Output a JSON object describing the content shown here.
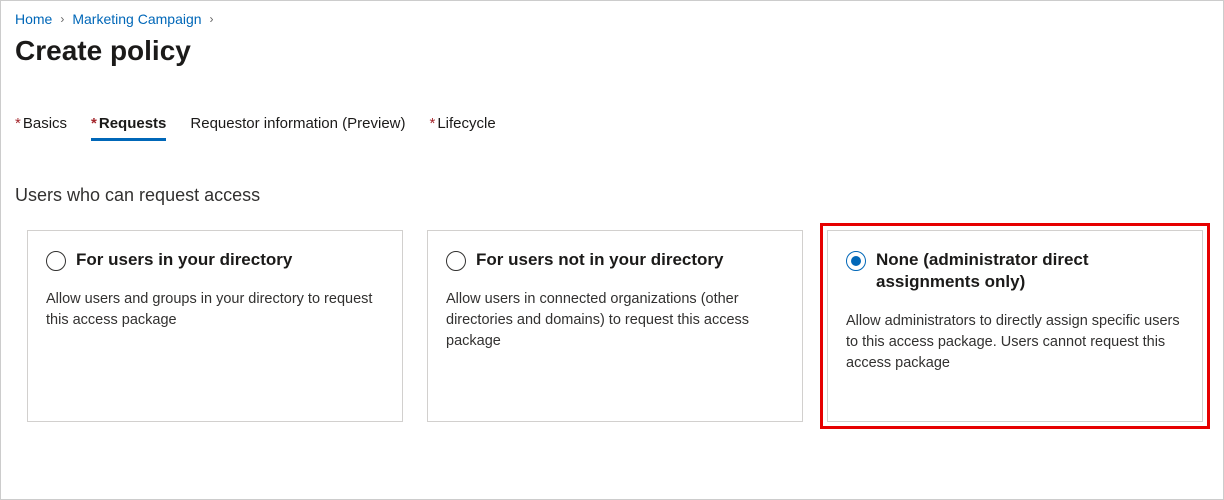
{
  "breadcrumb": {
    "home": "Home",
    "parent": "Marketing Campaign"
  },
  "page_title": "Create policy",
  "tabs": {
    "basics": {
      "label": "Basics",
      "required": true
    },
    "requests": {
      "label": "Requests",
      "required": true
    },
    "requestor_info": {
      "label": "Requestor information (Preview)",
      "required": false
    },
    "lifecycle": {
      "label": "Lifecycle",
      "required": true
    }
  },
  "section_heading": "Users who can request access",
  "options": {
    "in_directory": {
      "title": "For users in your directory",
      "description": "Allow users and groups in your directory to request this access package"
    },
    "not_in_directory": {
      "title": "For users not in your directory",
      "description": "Allow users in connected organizations (other directories and domains) to request this access package"
    },
    "none": {
      "title": "None (administrator direct assignments only)",
      "description": "Allow administrators to directly assign specific users to this access package. Users cannot request this access package"
    }
  }
}
